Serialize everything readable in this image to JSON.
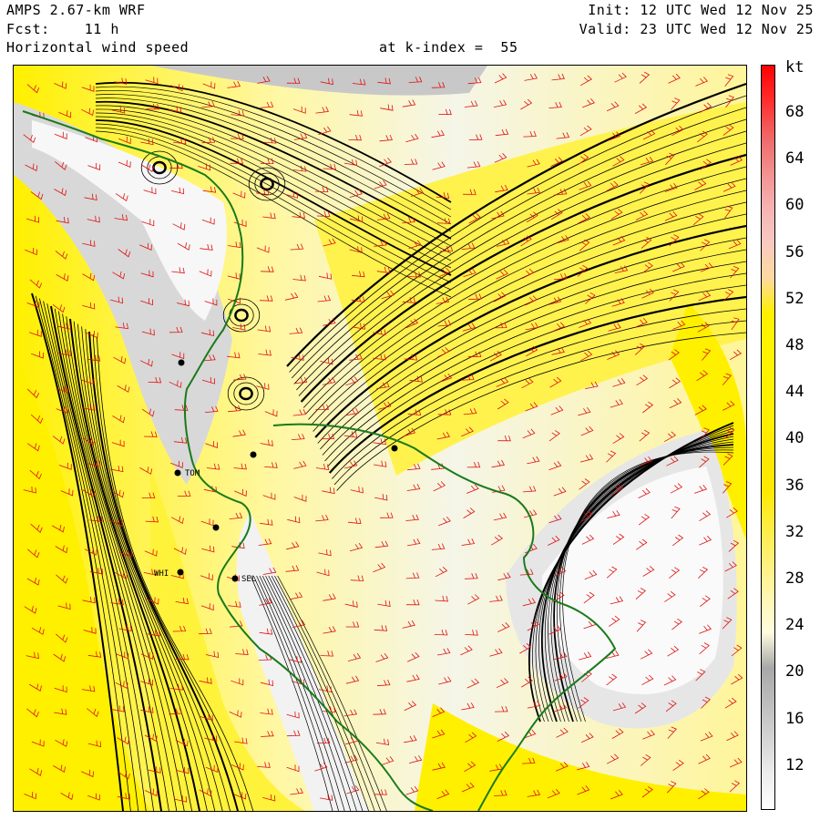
{
  "header": {
    "model": "AMPS 2.67-km WRF",
    "forecast": "Fcst:    11 h",
    "field": "Horizontal wind speed",
    "level": "at k-index =  55",
    "init": "Init: 12 UTC Wed 12 Nov 25",
    "valid": "Valid: 23 UTC Wed 12 Nov 25"
  },
  "colorbar": {
    "unit": "kt",
    "labels": [
      "68",
      "64",
      "60",
      "56",
      "52",
      "48",
      "44",
      "40",
      "36",
      "32",
      "28",
      "24",
      "20",
      "16",
      "12"
    ],
    "colors": [
      "#ffffff",
      "#ececec",
      "#d4d4d4",
      "#bdbdbd",
      "#a8a8a8",
      "#fffce0",
      "#fff6b0",
      "#fff07a",
      "#ffec40",
      "#ffe900",
      "#ffe800",
      "#fff000",
      "#fff200",
      "#fff400",
      "#fff000",
      "#fdd9a0",
      "#f9c9c0",
      "#f6b2b2",
      "#f38f8f",
      "#f06666",
      "#ff2e2e",
      "#ff0000"
    ]
  },
  "stations": [
    "TOM",
    "WHI",
    "SEL"
  ],
  "colors": {
    "coastline": "#1a7a1a",
    "barbs": "#e01010",
    "streamlines": "#000000",
    "fast_wind": "#fff000",
    "medium_wind": "#fffbc8",
    "slow_wind": "#cfcfcf"
  }
}
